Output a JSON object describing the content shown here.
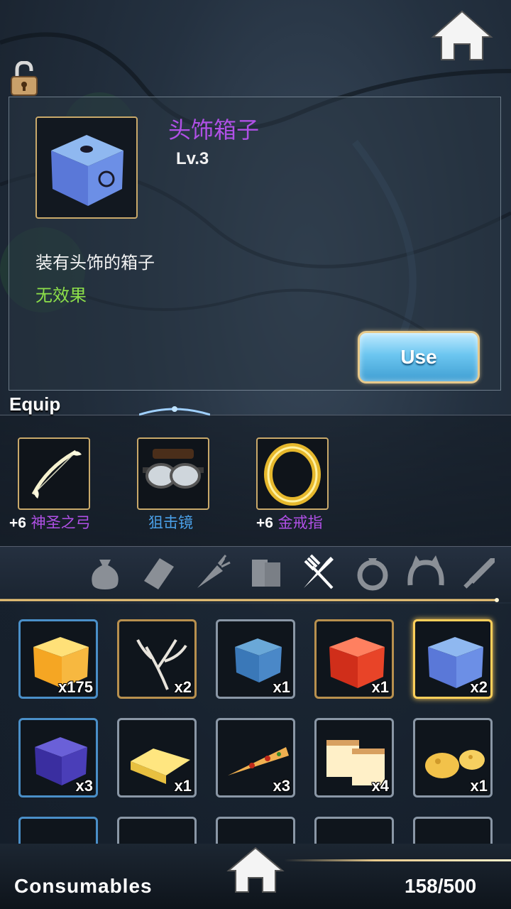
{
  "detail": {
    "name": "头饰箱子",
    "level": "Lv.3",
    "description": "装有头饰的箱子",
    "effect": "无效果",
    "use_label": "Use"
  },
  "equip": {
    "section_label": "Equip",
    "items": [
      {
        "plus": "+6",
        "name": "神圣之弓",
        "icon": "holy-bow-icon",
        "color": "#b050e6"
      },
      {
        "plus": "",
        "name": "狙击镜",
        "icon": "sniper-goggles-icon",
        "color": "#4aa0e8"
      },
      {
        "plus": "+6",
        "name": "金戒指",
        "icon": "gold-ring-icon",
        "color": "#b050e6"
      }
    ]
  },
  "tabs": [
    {
      "icon": "bag-icon",
      "active": false
    },
    {
      "icon": "scroll-icon",
      "active": false
    },
    {
      "icon": "carrot-icon",
      "active": false
    },
    {
      "icon": "books-icon",
      "active": false
    },
    {
      "icon": "fork-knife-icon",
      "active": true
    },
    {
      "icon": "ring-icon",
      "active": false
    },
    {
      "icon": "headband-icon",
      "active": false
    },
    {
      "icon": "sword-icon",
      "active": false
    }
  ],
  "inventory": [
    {
      "icon": "gold-box-icon",
      "qty": "x175"
    },
    {
      "icon": "branch-icon",
      "qty": "x2"
    },
    {
      "icon": "blue-box-icon",
      "qty": "x1"
    },
    {
      "icon": "red-box-icon",
      "qty": "x1"
    },
    {
      "icon": "headwear-box-icon",
      "qty": "x2",
      "selected": true
    },
    {
      "icon": "purple-box-icon",
      "qty": "x3"
    },
    {
      "icon": "butter-icon",
      "qty": "x1"
    },
    {
      "icon": "pizza-icon",
      "qty": "x3"
    },
    {
      "icon": "cake-icon",
      "qty": "x4"
    },
    {
      "icon": "cheese-icon",
      "qty": "x1"
    }
  ],
  "footer": {
    "category": "Consumables",
    "capacity": "158/500"
  },
  "colors": {
    "rarity_purple": "#b050e6",
    "rarity_blue": "#4aa0e8",
    "effect_green": "#8de04a",
    "selected_gold": "#ffcf5a"
  }
}
